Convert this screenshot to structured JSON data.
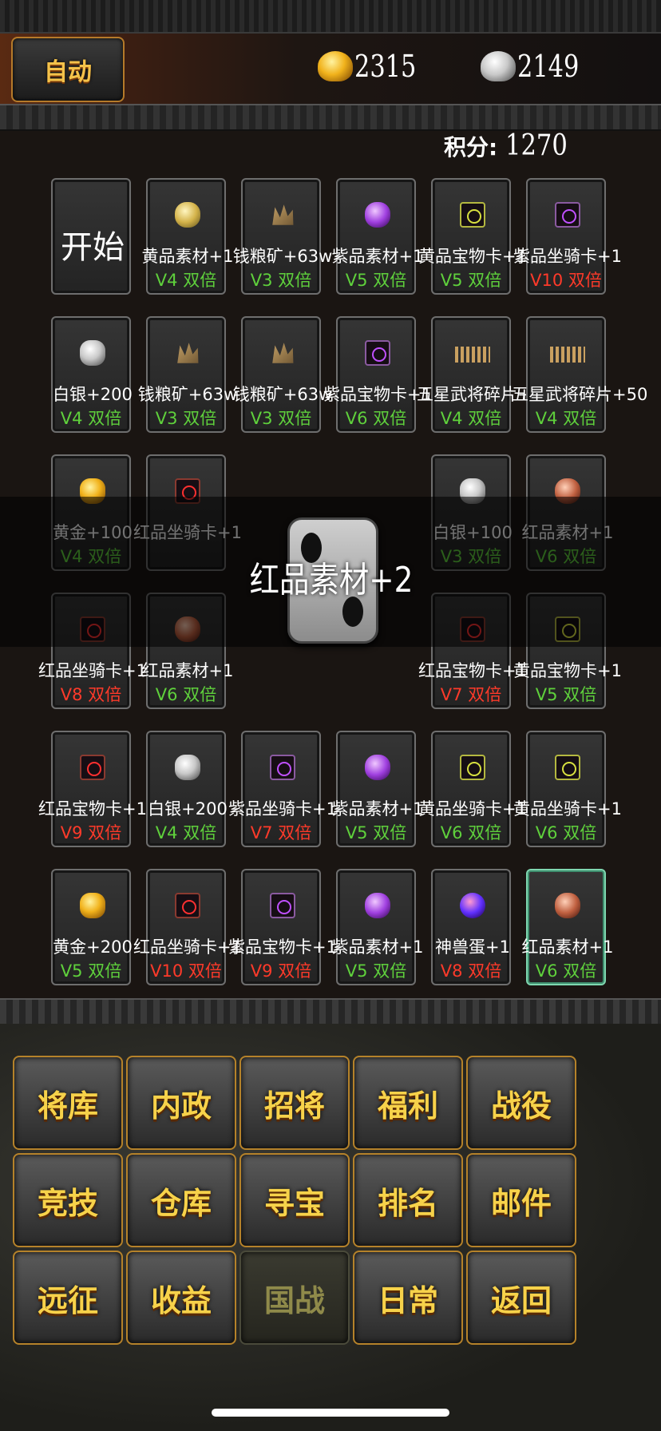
{
  "header": {
    "auto_label": "自动",
    "gold": "2315",
    "silver": "2149",
    "score_label": "积分:",
    "score_value": "1270"
  },
  "cells": [
    {
      "name": "开始",
      "mult": "",
      "color": "",
      "icon": "start"
    },
    {
      "name": "黄品素材+1",
      "mult": "V4 双倍",
      "color": "green",
      "icon": "ore-yellow"
    },
    {
      "name": "钱粮矿+63w",
      "mult": "V3 双倍",
      "color": "green",
      "icon": "grain"
    },
    {
      "name": "紫品素材+1",
      "mult": "V5 双倍",
      "color": "green",
      "icon": "ore-purple"
    },
    {
      "name": "黄品宝物卡+1",
      "mult": "V5 双倍",
      "color": "green",
      "icon": "card-yellow"
    },
    {
      "name": "紫品坐骑卡+1",
      "mult": "V10 双倍",
      "color": "red",
      "icon": "card-purple"
    },
    {
      "name": "白银+200",
      "mult": "V4 双倍",
      "color": "green",
      "icon": "silver"
    },
    {
      "name": "钱粮矿+63w",
      "mult": "V3 双倍",
      "color": "green",
      "icon": "grain"
    },
    {
      "name": "钱粮矿+63w",
      "mult": "V3 双倍",
      "color": "green",
      "icon": "grain"
    },
    {
      "name": "紫品宝物卡+1",
      "mult": "V6 双倍",
      "color": "green",
      "icon": "card-purple"
    },
    {
      "name": "五星武将碎片+50",
      "mult": "V4 双倍",
      "color": "green",
      "icon": "shards"
    },
    {
      "name": "五星武将碎片+50",
      "mult": "V4 双倍",
      "color": "green",
      "icon": "shards"
    },
    {
      "name": "黄金+100",
      "mult": "V4 双倍",
      "color": "green",
      "icon": "gold"
    },
    {
      "name": "红品坐骑卡+1",
      "mult": "",
      "color": "",
      "icon": "card-red"
    },
    {
      "name": "白银+100",
      "mult": "V3 双倍",
      "color": "green",
      "icon": "silver"
    },
    {
      "name": "红品素材+1",
      "mult": "V6 双倍",
      "color": "green",
      "icon": "ore-red"
    },
    {
      "name": "红品坐骑卡+1",
      "mult": "V8 双倍",
      "color": "red",
      "icon": "card-red"
    },
    {
      "name": "红品素材+1",
      "mult": "V6 双倍",
      "color": "green",
      "icon": "ore-red"
    },
    {
      "name": "红品宝物卡+1",
      "mult": "V7 双倍",
      "color": "red",
      "icon": "card-red"
    },
    {
      "name": "黄品宝物卡+1",
      "mult": "V5 双倍",
      "color": "green",
      "icon": "card-yellow"
    },
    {
      "name": "红品宝物卡+1",
      "mult": "V9 双倍",
      "color": "red",
      "icon": "card-red"
    },
    {
      "name": "白银+200",
      "mult": "V4 双倍",
      "color": "green",
      "icon": "silver"
    },
    {
      "name": "紫品坐骑卡+1",
      "mult": "V7 双倍",
      "color": "red",
      "icon": "card-purple"
    },
    {
      "name": "紫品素材+1",
      "mult": "V5 双倍",
      "color": "green",
      "icon": "ore-purple"
    },
    {
      "name": "黄品坐骑卡+1",
      "mult": "V6 双倍",
      "color": "green",
      "icon": "card-yellow"
    },
    {
      "name": "黄品坐骑卡+1",
      "mult": "V6 双倍",
      "color": "green",
      "icon": "card-yellow"
    },
    {
      "name": "黄金+200",
      "mult": "V5 双倍",
      "color": "green",
      "icon": "gold"
    },
    {
      "name": "红品坐骑卡+1",
      "mult": "V10 双倍",
      "color": "red",
      "icon": "card-red"
    },
    {
      "name": "紫品宝物卡+1",
      "mult": "V9 双倍",
      "color": "red",
      "icon": "card-purple"
    },
    {
      "name": "紫品素材+1",
      "mult": "V5 双倍",
      "color": "green",
      "icon": "ore-purple"
    },
    {
      "name": "神兽蛋+1",
      "mult": "V8 双倍",
      "color": "red",
      "icon": "egg"
    },
    {
      "name": "红品素材+1",
      "mult": "V6 双倍",
      "color": "green",
      "icon": "ore-red",
      "selected": true
    }
  ],
  "dice": {
    "result_text": "红品素材+2"
  },
  "menu": [
    {
      "label": "将库",
      "enabled": true
    },
    {
      "label": "内政",
      "enabled": true
    },
    {
      "label": "招将",
      "enabled": true
    },
    {
      "label": "福利",
      "enabled": true
    },
    {
      "label": "战役",
      "enabled": true
    },
    {
      "label": "竞技",
      "enabled": true
    },
    {
      "label": "仓库",
      "enabled": true
    },
    {
      "label": "寻宝",
      "enabled": true
    },
    {
      "label": "排名",
      "enabled": true
    },
    {
      "label": "邮件",
      "enabled": true
    },
    {
      "label": "远征",
      "enabled": true
    },
    {
      "label": "收益",
      "enabled": true
    },
    {
      "label": "国战",
      "enabled": false
    },
    {
      "label": "日常",
      "enabled": true
    },
    {
      "label": "返回",
      "enabled": true
    }
  ],
  "colors": {
    "accent_gold": "#f7d24a",
    "double_green": "#5fd13c",
    "double_red": "#ff3a2a",
    "selected_border": "#7fd7b0"
  }
}
